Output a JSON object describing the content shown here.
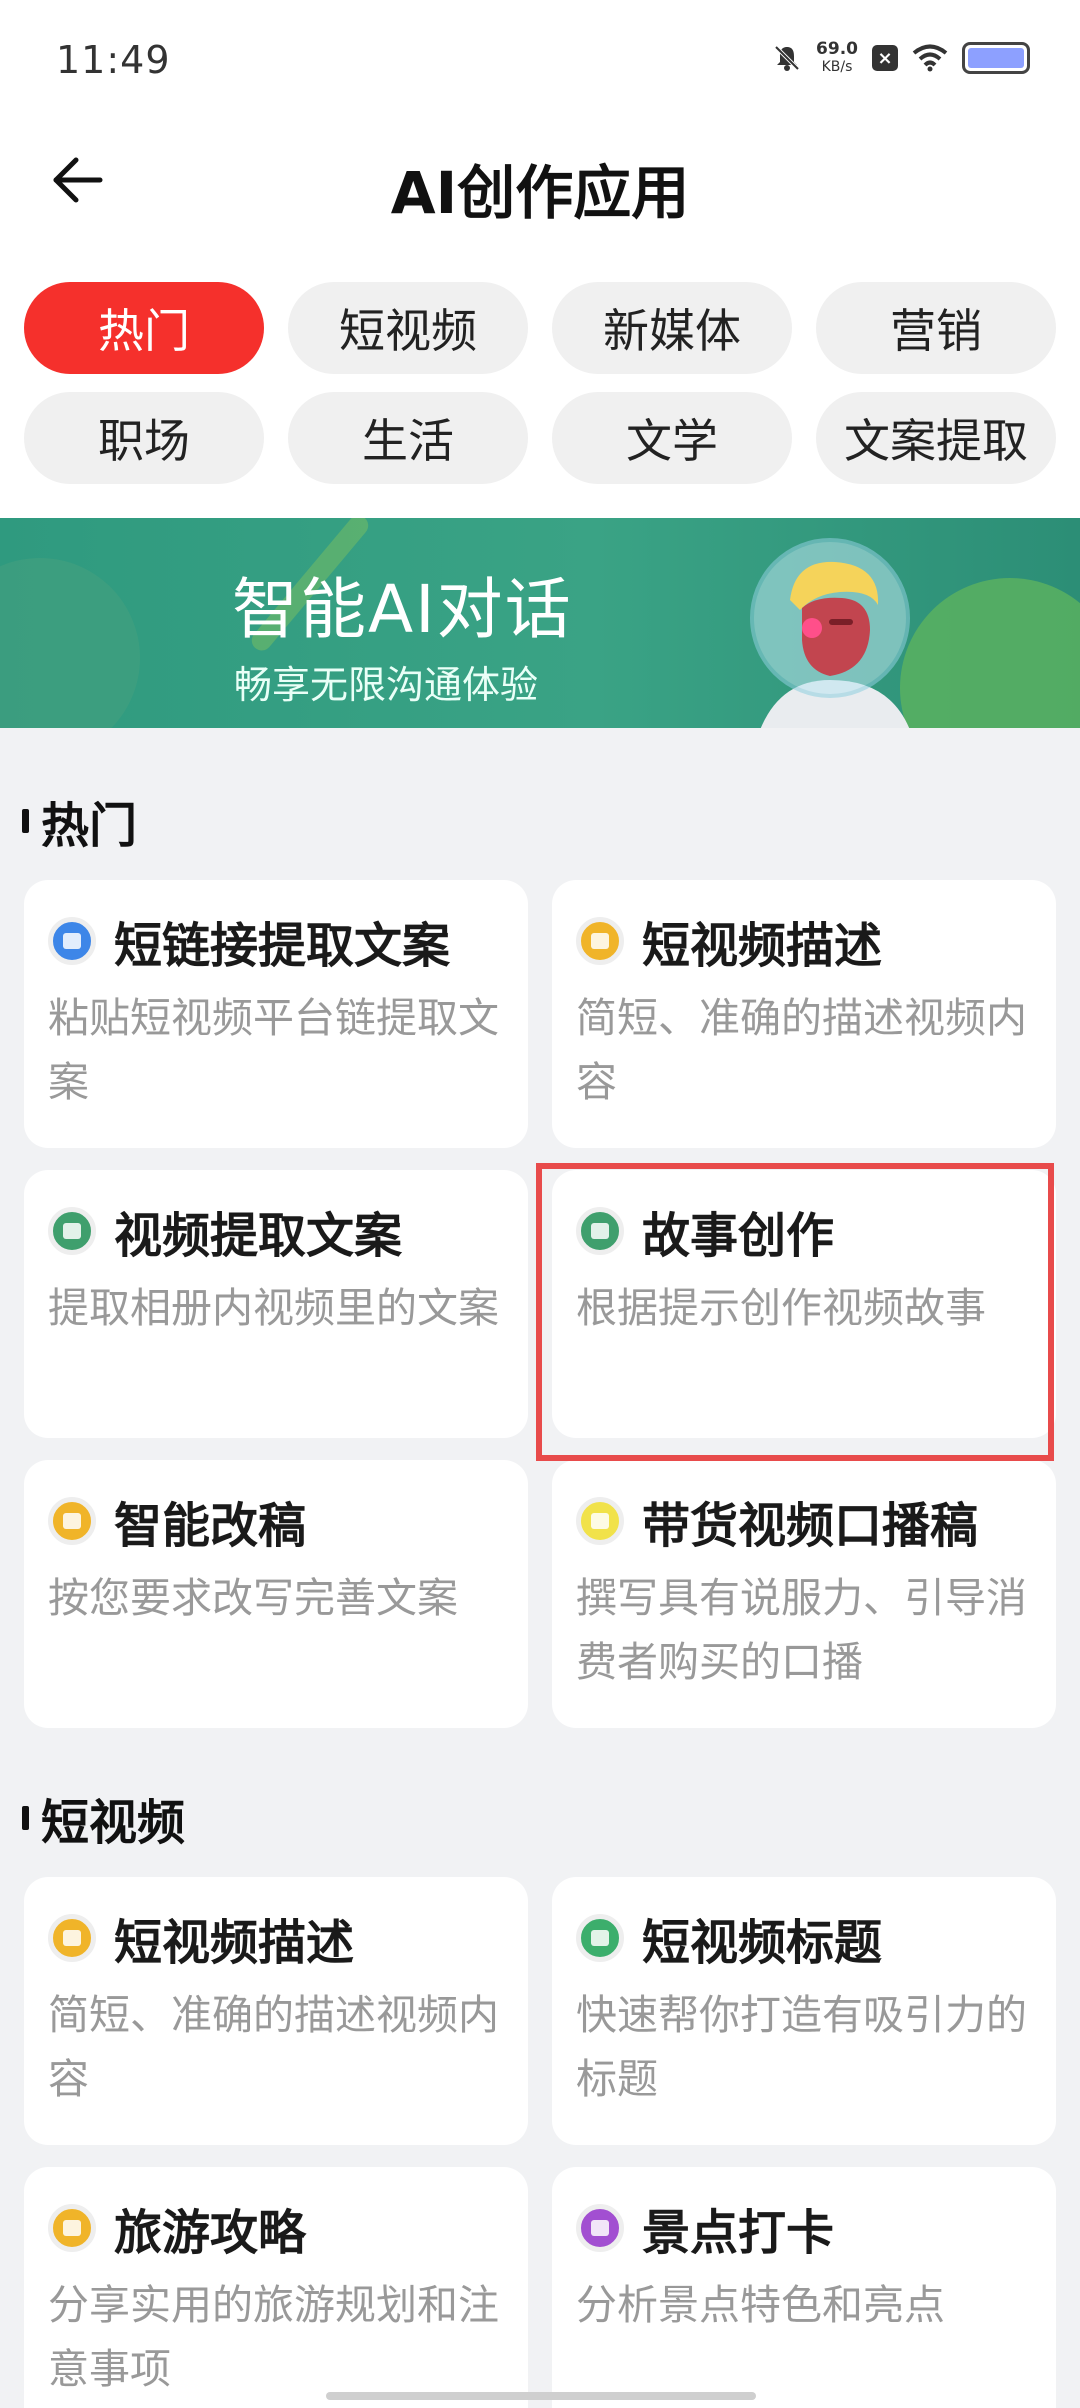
{
  "status": {
    "time": "11:49",
    "net_speed": "69.0",
    "net_unit": "KB/s",
    "battery_color": "#8da0ff"
  },
  "header": {
    "title": "AI创作应用"
  },
  "tabs": [
    {
      "label": "热门",
      "active": true
    },
    {
      "label": "短视频"
    },
    {
      "label": "新媒体"
    },
    {
      "label": "营销"
    },
    {
      "label": "职场"
    },
    {
      "label": "生活"
    },
    {
      "label": "文学"
    },
    {
      "label": "文案提取"
    }
  ],
  "banner": {
    "title": "智能AI对话",
    "subtitle": "畅享无限沟通体验"
  },
  "sections": [
    {
      "title": "热门",
      "cards": [
        {
          "title": "短链接提取文案",
          "desc": "粘贴短视频平台链提取文案",
          "icon": "play-icon",
          "color": "#3d86e8"
        },
        {
          "title": "短视频描述",
          "desc": "简短、准确的描述视频内容",
          "icon": "film-icon",
          "color": "#f0b429"
        },
        {
          "title": "视频提取文案",
          "desc": "提取相册内视频里的文案",
          "icon": "clapper-icon",
          "color": "#3f9f6d"
        },
        {
          "title": "故事创作",
          "desc": "根据提示创作视频故事",
          "icon": "clapper-icon",
          "color": "#3f9f6d"
        },
        {
          "title": "智能改稿",
          "desc": "按您要求改写完善文案",
          "icon": "film-icon",
          "color": "#f0b429"
        },
        {
          "title": "带货视频口播稿",
          "desc": "撰写具有说服力、引导消费者购买的口播",
          "icon": "mic-icon",
          "color": "#f1e24a"
        }
      ]
    },
    {
      "title": "短视频",
      "cards": [
        {
          "title": "短视频描述",
          "desc": "简短、准确的描述视频内容",
          "icon": "film-icon",
          "color": "#f0b429"
        },
        {
          "title": "短视频标题",
          "desc": "快速帮你打造有吸引力的标题",
          "icon": "frame-icon",
          "color": "#3cae6c"
        },
        {
          "title": "旅游攻略",
          "desc": "分享实用的旅游规划和注意事项",
          "icon": "mountain-icon",
          "color": "#f0b429"
        },
        {
          "title": "景点打卡",
          "desc": "分析景点特色和亮点",
          "icon": "photo-icon",
          "color": "#a24fd1"
        }
      ]
    }
  ]
}
